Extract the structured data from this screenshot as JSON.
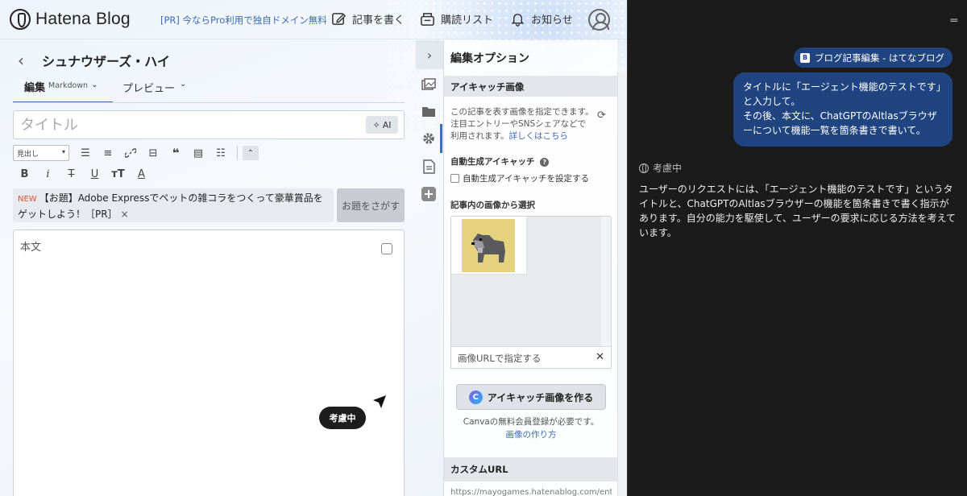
{
  "header": {
    "logo_text": "Hatena Blog",
    "pr_link": "[PR] 今ならPro利用で独自ドメイン無料",
    "write_label": "記事を書く",
    "reading_label": "購読リスト",
    "notice_label": "お知らせ"
  },
  "editor": {
    "back": "‹",
    "blog_name": "シュナウザーズ・ハイ",
    "tab_edit": "編集",
    "tab_edit_mode": "Markdown",
    "tab_preview": "プレビュー",
    "title_placeholder": "タイトル",
    "ai_label": "AI",
    "heading_select": "見出し",
    "topic_badge": "NEW",
    "topic_text": "【お題】Adobe Expressでペットの雑コラをつくって豪華賞品をゲットしよう！［PR］",
    "topic_close": "×",
    "topic_button": "お題をさがす",
    "body_placeholder": "本文",
    "thinking_pill": "考慮中"
  },
  "options": {
    "title": "編集オプション",
    "eyecatch_head": "アイキャッチ画像",
    "eyecatch_desc": "この記事を表す画像を指定できます。注目エントリーやSNSシェアなどで利用されます。",
    "eyecatch_link": "詳しくはこちら",
    "auto_head": "自動生成アイキャッチ",
    "auto_checkbox": "自動生成アイキャッチを設定する",
    "pick_head": "記事内の画像から選択",
    "url_label": "画像URLで指定する",
    "url_close": "✕",
    "canva_button": "アイキャッチ画像を作る",
    "canva_note": "Canvaの無料会員登録が必要です。",
    "canva_link": "画像の作り方",
    "custom_url_head": "カスタムURL",
    "custom_url_value": "https://mayogames.hatenablog.com/ent"
  },
  "assistant": {
    "tab_chip": "ブログ記事編集 - はてなブログ",
    "user_message_1": "タイトルに「エージェント機能のテストです」と入力して。",
    "user_message_2": "その後、本文に、ChatGPTのAltlasブラウザーについて機能一覧を箇条書きで書いて。",
    "thinking": "考慮中",
    "reply": "ユーザーのリクエストには、「エージェント機能のテストです」というタイトルと、ChatGPTのAltlasブラウザーの機能を箇条書きで書く指示があります。自分の能力を駆使して、ユーザーの要求に応じる方法を考えています。"
  },
  "colors": {
    "accent_blue": "#3b6fb6",
    "chat_bubble": "#20447f",
    "assistant_bg": "#1b1b1b",
    "new_badge": "#e0522c"
  }
}
